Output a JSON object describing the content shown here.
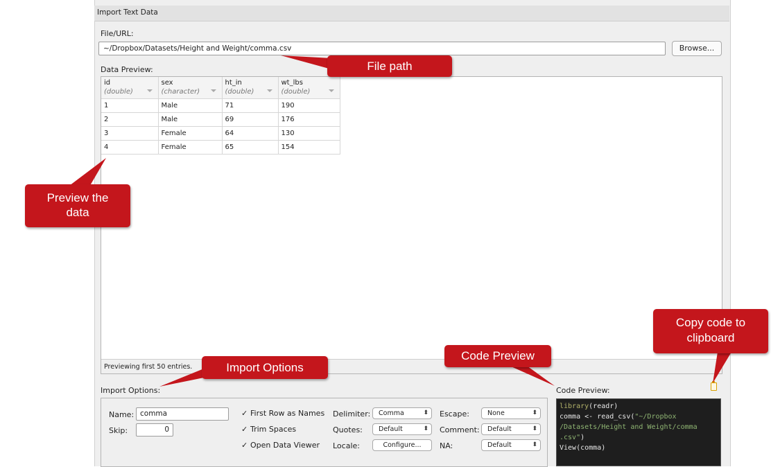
{
  "window": {
    "title": "Import Text Data"
  },
  "file": {
    "label": "File/URL:",
    "path": "~/Dropbox/Datasets/Height and Weight/comma.csv",
    "browse_label": "Browse..."
  },
  "preview": {
    "label": "Data Preview:",
    "columns": [
      {
        "name": "id",
        "type": "(double)"
      },
      {
        "name": "sex",
        "type": "(character)"
      },
      {
        "name": "ht_in",
        "type": "(double)"
      },
      {
        "name": "wt_lbs",
        "type": "(double)"
      }
    ],
    "rows": [
      [
        "1",
        "Male",
        "71",
        "190"
      ],
      [
        "2",
        "Male",
        "69",
        "176"
      ],
      [
        "3",
        "Female",
        "64",
        "130"
      ],
      [
        "4",
        "Female",
        "65",
        "154"
      ]
    ],
    "footer": "Previewing first 50 entries."
  },
  "options": {
    "label": "Import Options:",
    "name_label": "Name:",
    "name_value": "comma",
    "skip_label": "Skip:",
    "skip_value": "0",
    "first_row": "First Row as Names",
    "trim_spaces": "Trim Spaces",
    "open_viewer": "Open Data Viewer",
    "check_mark": "✓",
    "delimiter_label": "Delimiter:",
    "delimiter_value": "Comma",
    "quotes_label": "Quotes:",
    "quotes_value": "Default",
    "locale_label": "Locale:",
    "locale_button": "Configure...",
    "escape_label": "Escape:",
    "escape_value": "None",
    "comment_label": "Comment:",
    "comment_value": "Default",
    "na_label": "NA:",
    "na_value": "Default"
  },
  "code": {
    "label": "Code Preview:",
    "l1_kw": "library",
    "l1_rest": "(readr)",
    "l2": "comma <- read_csv(",
    "l2_str": "\"~/Dropbox",
    "l3": "/Datasets/Height and Weight/comma",
    "l4": ".csv\"",
    "l4_end": ")",
    "l5": "View(comma)"
  },
  "annotations": {
    "file_path": "File path",
    "preview_data_1": "Preview the",
    "preview_data_2": "data",
    "import_options": "Import Options",
    "code_preview": "Code Preview",
    "copy_1": "Copy code to",
    "copy_2": "clipboard"
  },
  "colors": {
    "callout": "#c4161c",
    "code_bg": "#1e1e1e",
    "clipboard": "#d8a000"
  }
}
